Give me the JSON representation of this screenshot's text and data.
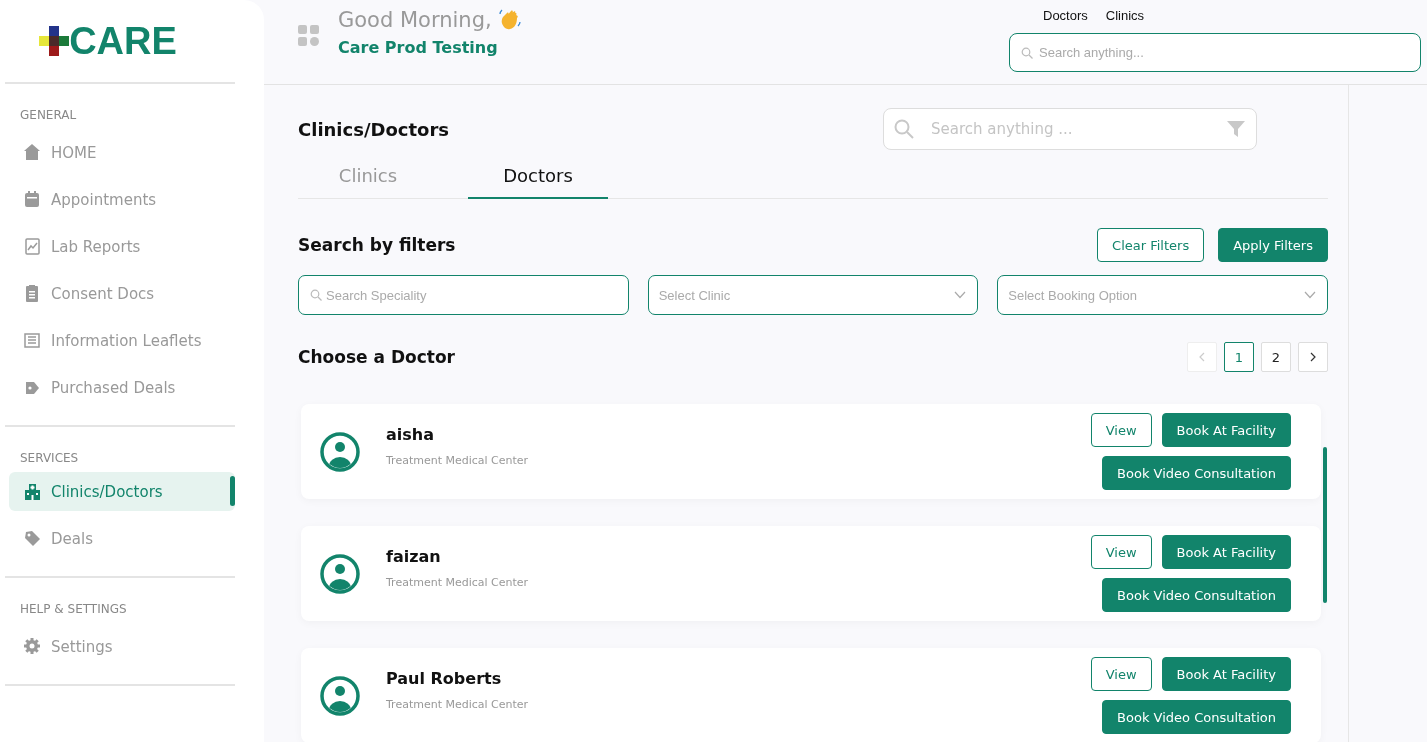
{
  "logo": {
    "text": "CARE"
  },
  "sidebar": {
    "sections": [
      {
        "heading": "GENERAL",
        "items": [
          {
            "label": "HOME",
            "selected": false
          },
          {
            "label": "Appointments",
            "selected": false
          },
          {
            "label": "Lab Reports",
            "selected": false
          },
          {
            "label": "Consent Docs",
            "selected": false
          },
          {
            "label": "Information Leaflets",
            "selected": false
          },
          {
            "label": "Purchased Deals",
            "selected": false
          }
        ]
      },
      {
        "heading": "SERVICES",
        "items": [
          {
            "label": "Clinics/Doctors",
            "selected": true
          },
          {
            "label": "Deals",
            "selected": false
          }
        ]
      },
      {
        "heading": "HELP & SETTINGS",
        "items": [
          {
            "label": "Settings",
            "selected": false
          }
        ]
      }
    ]
  },
  "header": {
    "greeting": "Good Morning,",
    "user": "Care Prod Testing",
    "links": [
      "Doctors",
      "Clinics"
    ],
    "search": {
      "placeholder": "Search anything..."
    }
  },
  "page": {
    "title": "Clinics/Doctors",
    "search": {
      "placeholder": "Search anything ..."
    },
    "tabs": [
      {
        "label": "Clinics",
        "selected": false
      },
      {
        "label": "Doctors",
        "selected": true
      }
    ],
    "filters": {
      "title": "Search by filters",
      "buttons": [
        {
          "label": "Clear Filters",
          "kind": "outline"
        },
        {
          "label": "Apply Filters",
          "kind": "solid"
        }
      ],
      "fields": [
        {
          "kind": "search",
          "placeholder": "Search Speciality"
        },
        {
          "kind": "select",
          "placeholder": "Select Clinic"
        },
        {
          "kind": "select",
          "placeholder": "Select Booking Option"
        }
      ]
    },
    "list_title": "Choose a Doctor",
    "pagination": {
      "prev_disabled": true,
      "next_disabled": false,
      "pages": [
        {
          "label": "1",
          "selected": true
        },
        {
          "label": "2",
          "selected": false
        }
      ]
    },
    "doctors": [
      {
        "name": "aisha",
        "clinic": "Treatment Medical Center",
        "actions": [
          {
            "label": "View",
            "kind": "outline"
          },
          {
            "label": "Book At Facility",
            "kind": "solid"
          },
          {
            "label": "Book Video Consultation",
            "kind": "solid"
          }
        ]
      },
      {
        "name": "faizan",
        "clinic": "Treatment Medical Center",
        "actions": [
          {
            "label": "View",
            "kind": "outline"
          },
          {
            "label": "Book At Facility",
            "kind": "solid"
          },
          {
            "label": "Book Video Consultation",
            "kind": "solid"
          }
        ]
      },
      {
        "name": "Paul Roberts",
        "clinic": "Treatment Medical Center",
        "actions": [
          {
            "label": "View",
            "kind": "outline"
          },
          {
            "label": "Book At Facility",
            "kind": "solid"
          },
          {
            "label": "Book Video Consultation",
            "kind": "solid"
          }
        ]
      }
    ]
  }
}
